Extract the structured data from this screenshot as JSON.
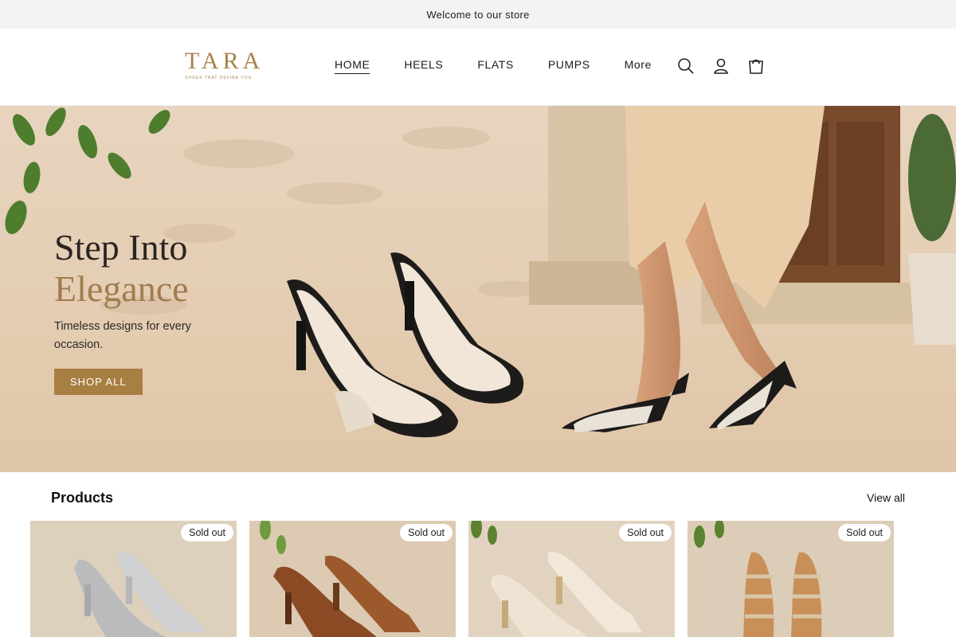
{
  "announcement": "Welcome to our store",
  "header": {
    "logo_word": "TARA",
    "logo_tagline": "SHOES THAT DEFINE YOU",
    "nav": [
      {
        "label": "HOME",
        "active": true
      },
      {
        "label": "HEELS"
      },
      {
        "label": "FLATS"
      },
      {
        "label": "PUMPS"
      },
      {
        "label": "More"
      }
    ],
    "icons": [
      "search-icon",
      "account-icon",
      "cart-icon"
    ]
  },
  "hero": {
    "title_line1": "Step Into",
    "title_line2": "Elegance",
    "subtitle": "Timeless designs for every occasion.",
    "cta_label": "SHOP ALL"
  },
  "products": {
    "heading": "Products",
    "view_all": "View all",
    "items": [
      {
        "badge": "Sold out",
        "color": "silver"
      },
      {
        "badge": "Sold out",
        "color": "brown"
      },
      {
        "badge": "Sold out",
        "color": "cream"
      },
      {
        "badge": "Sold out",
        "color": "gold"
      }
    ]
  },
  "colors": {
    "brand_gold": "#a87f42",
    "text_dark": "#1b1b1b",
    "announce_bg": "#f3f3f3"
  }
}
